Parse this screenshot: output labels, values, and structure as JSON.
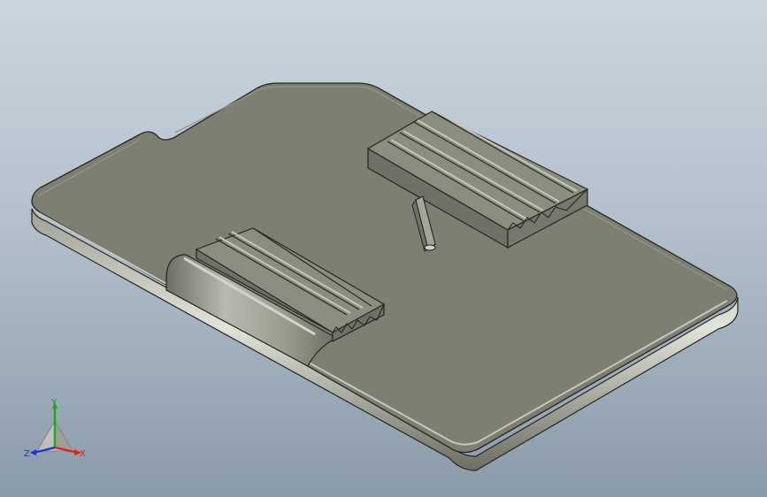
{
  "model": {
    "part": "card-holder-plate",
    "colors": {
      "background_top": "#cbd5de",
      "background_bottom": "#8a9baa",
      "face_top": "#7e7f73",
      "face_edge": "#95968a",
      "face_side": "#6a6b61",
      "highlight": "#d8d9d0",
      "outline": "#25261f"
    }
  },
  "triad": {
    "x_label": "X",
    "y_label": "Y",
    "z_label": "Z",
    "x_color": "#e0201d",
    "y_color": "#1fa61c",
    "z_color": "#1c37d6"
  }
}
